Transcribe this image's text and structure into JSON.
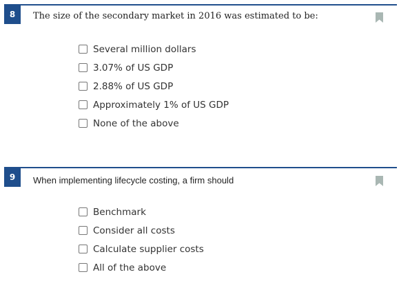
{
  "questions": [
    {
      "number": "8",
      "text": "The size of the secondary market in 2016 was estimated to be:",
      "options": [
        "Several million dollars",
        "3.07% of US GDP",
        "2.88% of US GDP",
        "Approximately 1% of US GDP",
        "None of the above"
      ]
    },
    {
      "number": "9",
      "text": "When implementing lifecycle costing, a firm should",
      "options": [
        "Benchmark",
        "Consider all costs",
        "Calculate supplier costs",
        "All of the above"
      ]
    }
  ],
  "colors": {
    "accent": "#1f4e8c",
    "bookmark": "#a9b7b3"
  },
  "icons": {
    "bookmark": "bookmark-icon",
    "checkbox": "checkbox-icon"
  }
}
